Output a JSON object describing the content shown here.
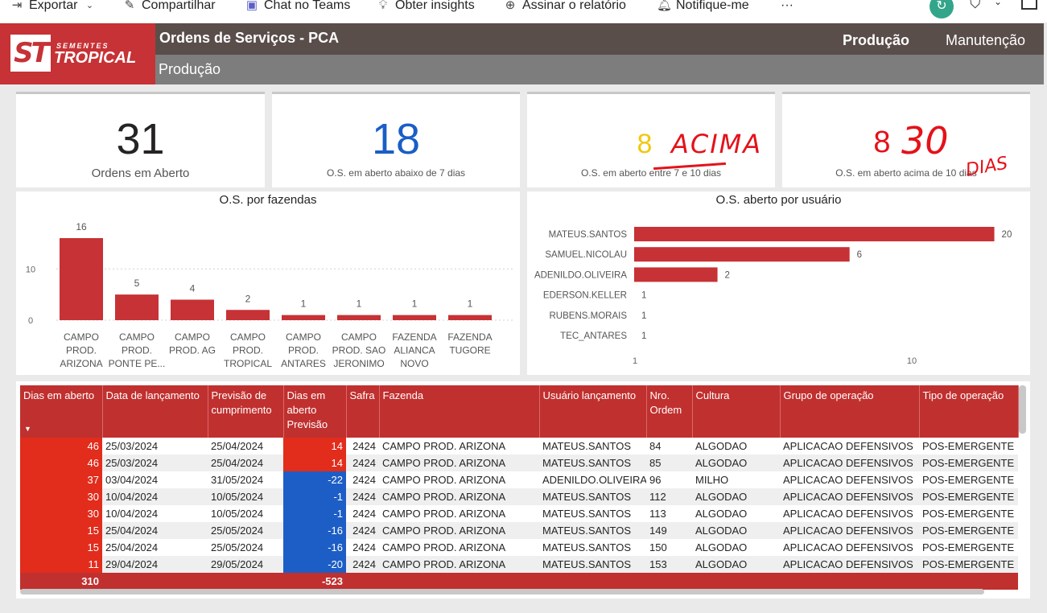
{
  "toolbar": {
    "items": [
      {
        "label": "Exportar",
        "icon": "export-icon"
      },
      {
        "label": "Compartilhar",
        "icon": "share-icon"
      },
      {
        "label": "Chat no Teams",
        "icon": "teams-icon"
      },
      {
        "label": "Obter insights",
        "icon": "lightbulb-icon"
      },
      {
        "label": "Assinar o relatório",
        "icon": "subscribe-icon"
      },
      {
        "label": "Notifique-me",
        "icon": "bell-icon"
      }
    ],
    "more": "···"
  },
  "logo": {
    "initials": "ST",
    "sub": "SEMENTES",
    "main": "TROPICAL"
  },
  "header": {
    "title": "Ordens de Serviços - PCA",
    "subtitle": "Produção",
    "nav": [
      "Produção",
      "Manutenção"
    ]
  },
  "kpis": [
    {
      "value": "31",
      "label": "Ordens em Aberto",
      "color": "#252423"
    },
    {
      "value": "18",
      "label": "O.S. em aberto abaixo de 7 dias",
      "color": "#1a5ec6"
    },
    {
      "value": "8",
      "label": "O.S. em aberto entre 7 e 10 dias",
      "color": "#f2c80f"
    },
    {
      "value": "8",
      "label": "O.S. em aberto acima de 10 dias",
      "color": "#e4121a"
    }
  ],
  "annotations": {
    "acima": "ACIMA",
    "trinta": "30",
    "dias": "DIAS"
  },
  "chart_fazendas": {
    "title": "O.S. por fazendas",
    "chart_data": {
      "type": "bar",
      "categories": [
        "CAMPO PROD. ARIZONA",
        "CAMPO PROD. PONTE PE...",
        "CAMPO PROD. AG",
        "CAMPO PROD. TROPICAL",
        "CAMPO PROD. ANTARES",
        "CAMPO PROD. SAO JERONIMO",
        "FAZENDA ALIANCA NOVO",
        "FAZENDA TUGORE"
      ],
      "category_lines": [
        [
          "CAMPO",
          "PROD.",
          "ARIZONA"
        ],
        [
          "CAMPO",
          "PROD.",
          "PONTE PE..."
        ],
        [
          "CAMPO",
          "PROD. AG"
        ],
        [
          "CAMPO",
          "PROD.",
          "TROPICAL"
        ],
        [
          "CAMPO",
          "PROD.",
          "ANTARES"
        ],
        [
          "CAMPO",
          "PROD. SAO",
          "JERONIMO"
        ],
        [
          "FAZENDA",
          "ALIANCA",
          "NOVO"
        ],
        [
          "FAZENDA",
          "TUGORE"
        ]
      ],
      "values": [
        16,
        5,
        4,
        2,
        1,
        1,
        1,
        1
      ],
      "ylim": [
        0,
        16
      ],
      "yticks": [
        0,
        10
      ],
      "color": "#c63235"
    }
  },
  "chart_usuarios": {
    "title": "O.S. aberto por usuário",
    "chart_data": {
      "type": "bar",
      "orientation": "horizontal",
      "categories": [
        "MATEUS.SANTOS",
        "SAMUEL.NICOLAU",
        "ADENILDO.OLIVEIRA",
        "EDERSON.KELLER",
        "RUBENS.MORAIS",
        "TEC_ANTARES"
      ],
      "values": [
        20,
        6,
        2,
        1,
        1,
        1
      ],
      "xscale": "log",
      "xticks": [
        1,
        10
      ],
      "color": "#c63235"
    }
  },
  "table": {
    "columns": [
      "Dias em aberto",
      "Data de lançamento",
      "Previsão de cumprimento",
      "Dias em aberto Previsão",
      "Safra",
      "Fazenda",
      "Usuário lançamento",
      "Nro. Ordem",
      "Cultura",
      "Grupo de operação",
      "Tipo de operação"
    ],
    "sort_icon": "sort-desc-icon",
    "rows": [
      [
        "46",
        "25/03/2024",
        "25/04/2024",
        "14",
        "2424",
        "CAMPO PROD. ARIZONA",
        "MATEUS.SANTOS",
        "84",
        "ALGODAO",
        "APLICACAO DEFENSIVOS",
        "POS-EMERGENTE"
      ],
      [
        "46",
        "25/03/2024",
        "25/04/2024",
        "14",
        "2424",
        "CAMPO PROD. ARIZONA",
        "MATEUS.SANTOS",
        "85",
        "ALGODAO",
        "APLICACAO DEFENSIVOS",
        "POS-EMERGENTE"
      ],
      [
        "37",
        "03/04/2024",
        "31/05/2024",
        "-22",
        "2424",
        "CAMPO PROD. ARIZONA",
        "ADENILDO.OLIVEIRA",
        "96",
        "MILHO",
        "APLICACAO DEFENSIVOS",
        "POS-EMERGENTE"
      ],
      [
        "30",
        "10/04/2024",
        "10/05/2024",
        "-1",
        "2424",
        "CAMPO PROD. ARIZONA",
        "MATEUS.SANTOS",
        "112",
        "ALGODAO",
        "APLICACAO DEFENSIVOS",
        "POS-EMERGENTE"
      ],
      [
        "30",
        "10/04/2024",
        "10/05/2024",
        "-1",
        "2424",
        "CAMPO PROD. ARIZONA",
        "MATEUS.SANTOS",
        "113",
        "ALGODAO",
        "APLICACAO DEFENSIVOS",
        "POS-EMERGENTE"
      ],
      [
        "15",
        "25/04/2024",
        "25/05/2024",
        "-16",
        "2424",
        "CAMPO PROD. ARIZONA",
        "MATEUS.SANTOS",
        "149",
        "ALGODAO",
        "APLICACAO DEFENSIVOS",
        "POS-EMERGENTE"
      ],
      [
        "15",
        "25/04/2024",
        "25/05/2024",
        "-16",
        "2424",
        "CAMPO PROD. ARIZONA",
        "MATEUS.SANTOS",
        "150",
        "ALGODAO",
        "APLICACAO DEFENSIVOS",
        "POS-EMERGENTE"
      ],
      [
        "11",
        "29/04/2024",
        "29/05/2024",
        "-20",
        "2424",
        "CAMPO PROD. ARIZONA",
        "MATEUS.SANTOS",
        "153",
        "ALGODAO",
        "APLICACAO DEFENSIVOS",
        "POS-EMERGENTE"
      ]
    ],
    "totals": {
      "dias_em_aberto": "310",
      "dias_previsao": "-523"
    }
  }
}
